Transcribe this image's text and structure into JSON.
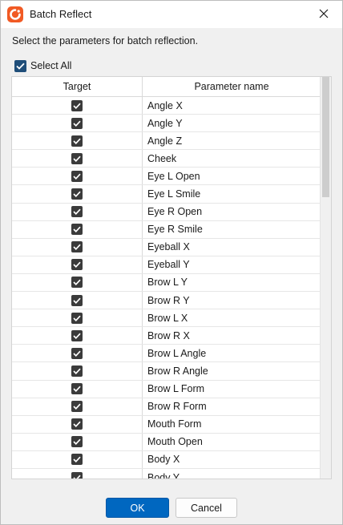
{
  "window": {
    "title": "Batch Reflect",
    "close_icon": "close-icon",
    "app_icon": "app-logo-icon",
    "accent_color": "#f15a24"
  },
  "instructions": "Select the parameters for batch reflection.",
  "select_all": {
    "label": "Select All",
    "checked": true
  },
  "table": {
    "columns": [
      "Target",
      "Parameter name"
    ],
    "rows": [
      {
        "checked": true,
        "name": "Angle X"
      },
      {
        "checked": true,
        "name": "Angle Y"
      },
      {
        "checked": true,
        "name": "Angle Z"
      },
      {
        "checked": true,
        "name": "Cheek"
      },
      {
        "checked": true,
        "name": "Eye L Open"
      },
      {
        "checked": true,
        "name": "Eye L Smile"
      },
      {
        "checked": true,
        "name": "Eye R Open"
      },
      {
        "checked": true,
        "name": "Eye R Smile"
      },
      {
        "checked": true,
        "name": "Eyeball X"
      },
      {
        "checked": true,
        "name": "Eyeball Y"
      },
      {
        "checked": true,
        "name": "Brow L Y"
      },
      {
        "checked": true,
        "name": "Brow R Y"
      },
      {
        "checked": true,
        "name": "Brow L X"
      },
      {
        "checked": true,
        "name": "Brow R X"
      },
      {
        "checked": true,
        "name": "Brow L Angle"
      },
      {
        "checked": true,
        "name": "Brow R Angle"
      },
      {
        "checked": true,
        "name": "Brow L Form"
      },
      {
        "checked": true,
        "name": "Brow R Form"
      },
      {
        "checked": true,
        "name": "Mouth Form"
      },
      {
        "checked": true,
        "name": "Mouth Open"
      },
      {
        "checked": true,
        "name": "Body X"
      },
      {
        "checked": true,
        "name": "Body Y"
      }
    ]
  },
  "buttons": {
    "ok": "OK",
    "cancel": "Cancel"
  },
  "colors": {
    "ok_button": "#0067c0",
    "checkbox": "#3b3b3b"
  }
}
